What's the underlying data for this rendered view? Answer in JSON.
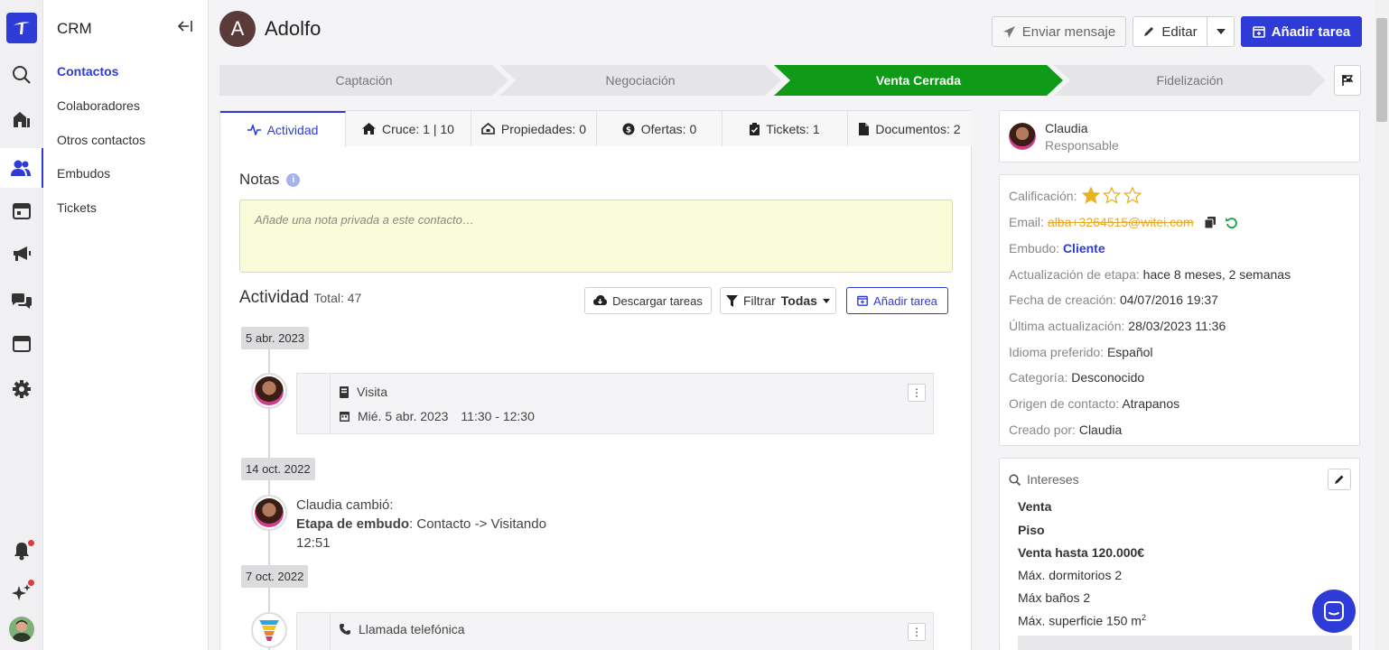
{
  "sidebar": {
    "title": "CRM",
    "items": [
      {
        "label": "Contactos"
      },
      {
        "label": "Colaboradores"
      },
      {
        "label": "Otros contactos"
      },
      {
        "label": "Embudos"
      },
      {
        "label": "Tickets"
      }
    ]
  },
  "header": {
    "initial": "A",
    "name": "Adolfo",
    "send_label": "Enviar mensaje",
    "edit_label": "Editar",
    "add_task_label": "Añadir tarea"
  },
  "pipeline": {
    "stages": [
      {
        "label": "Captación"
      },
      {
        "label": "Negociación"
      },
      {
        "label": "Venta Cerrada"
      },
      {
        "label": "Fidelización"
      }
    ],
    "active_index": 2
  },
  "tabs": [
    {
      "label": "Actividad"
    },
    {
      "label": "Cruce: 1 | 10"
    },
    {
      "label": "Propiedades: 0"
    },
    {
      "label": "Ofertas: 0"
    },
    {
      "label": "Tickets: 1"
    },
    {
      "label": "Documentos: 2"
    }
  ],
  "notes": {
    "title": "Notas",
    "placeholder": "Añade una nota privada a este contacto…"
  },
  "activity": {
    "title": "Actividad",
    "total": "Total: 47",
    "download_label": "Descargar tareas",
    "filter_label": "Filtrar",
    "filter_value": "Todas",
    "add_task_label": "Añadir tarea",
    "groups": [
      {
        "date": "5 abr. 2023",
        "type": "Visita",
        "when": "Mié. 5 abr. 2023",
        "time": "11:30 - 12:30"
      },
      {
        "date": "14 oct. 2022",
        "author": "Claudia cambió:",
        "field": "Etapa de embudo",
        "change": ": Contacto -> Visitando",
        "time": "12:51"
      },
      {
        "date": "7 oct. 2022",
        "type": "Llamada telefónica"
      }
    ]
  },
  "owner": {
    "name": "Claudia",
    "role": "Responsable"
  },
  "details": {
    "rating_label": "Calificación:",
    "rating_value": 1,
    "rating_max": 3,
    "email_label": "Email:",
    "email": "alba+3264515@witei.com",
    "funnel_label": "Embudo:",
    "funnel": "Cliente",
    "stage_update_label": "Actualización de etapa:",
    "stage_update": "hace 8 meses, 2 semanas",
    "created_label": "Fecha de creación:",
    "created": "04/07/2016 19:37",
    "updated_label": "Última actualización:",
    "updated": "28/03/2023 11:36",
    "language_label": "Idioma preferido:",
    "language": "Español",
    "category_label": "Categoría:",
    "category": "Desconocido",
    "origin_label": "Origen de contacto:",
    "origin": "Atrapanos",
    "creator_label": "Creado por:",
    "creator": "Claudia"
  },
  "interests": {
    "title": "Intereses",
    "items": [
      {
        "text": "Venta",
        "bold": true
      },
      {
        "text": "Piso",
        "bold": true
      },
      {
        "text": "Venta hasta 120.000€",
        "bold": true
      },
      {
        "text": "Máx. dormitorios 2",
        "bold": false
      },
      {
        "text": "Máx baños 2",
        "bold": false
      },
      {
        "text": "Máx. superficie 150 m",
        "bold": false
      }
    ],
    "superscript": "2"
  },
  "colors": {
    "accent": "#2f3bd6",
    "stage_active": "#0f9a17",
    "success": "#1a9b3c",
    "note_bg": "#fafbd9"
  }
}
